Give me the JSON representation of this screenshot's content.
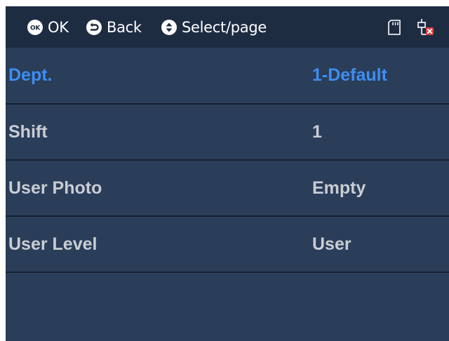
{
  "hints": {
    "ok_icon": "ok-circle-icon",
    "ok_label": "OK",
    "back_icon": "back-arrow-icon",
    "back_label": "Back",
    "select_icon": "up-down-icon",
    "select_label": "Select/page"
  },
  "status": {
    "sd_icon": "sd-card-icon",
    "network_icon": "network-disconnected-icon"
  },
  "rows": [
    {
      "label": "Dept.",
      "value": "1-Default",
      "selected": true
    },
    {
      "label": "Shift",
      "value": "1",
      "selected": false
    },
    {
      "label": "User Photo",
      "value": "Empty",
      "selected": false
    },
    {
      "label": "User Level",
      "value": "User",
      "selected": false
    }
  ],
  "colors": {
    "background": "#2a3d59",
    "topbar": "#1e2c42",
    "selected_text": "#3d8ef2",
    "normal_text": "#c9cdd3",
    "divider": "#16212f"
  }
}
